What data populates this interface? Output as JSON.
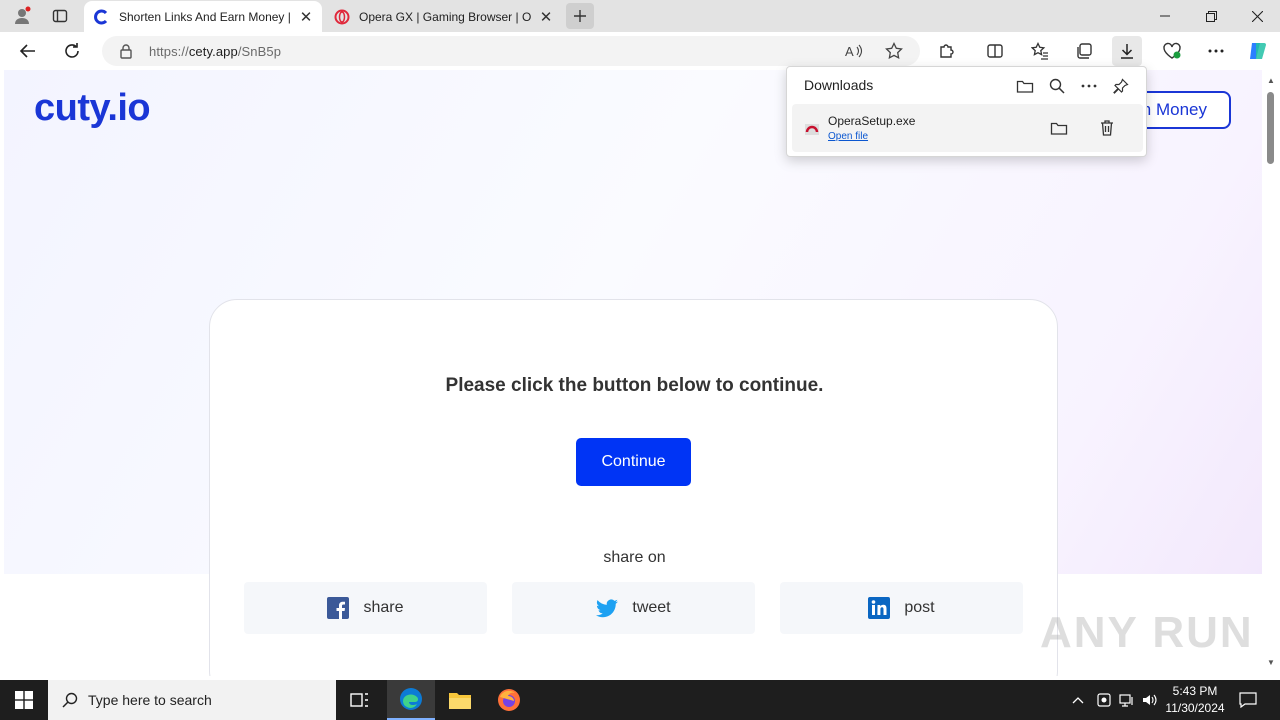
{
  "browser": {
    "tabs": [
      {
        "title": "Shorten Links And Earn Money | C",
        "active": true
      },
      {
        "title": "Opera GX | Gaming Browser | Ope",
        "active": false
      }
    ],
    "address": {
      "scheme": "https://",
      "host": "cety.app",
      "path": "/SnB5p"
    }
  },
  "downloads": {
    "title": "Downloads",
    "items": [
      {
        "filename": "OperaSetup.exe",
        "action_label": "Open file"
      }
    ]
  },
  "page": {
    "logo": "cuty.io",
    "earn_button": "n Money",
    "message": "Please click the button below to continue.",
    "continue_label": "Continue",
    "share_heading": "share on",
    "share_buttons": [
      {
        "network": "facebook",
        "label": "share",
        "color": "#3b5998"
      },
      {
        "network": "twitter",
        "label": "tweet",
        "color": "#1da1f2"
      },
      {
        "network": "linkedin",
        "label": "post",
        "color": "#0a66c2"
      }
    ],
    "watermark": "ANY RUN"
  },
  "taskbar": {
    "search_placeholder": "Type here to search",
    "time": "5:43 PM",
    "date": "11/30/2024"
  },
  "colors": {
    "brand": "#1a36d6",
    "continue_bg": "#0034f5"
  }
}
